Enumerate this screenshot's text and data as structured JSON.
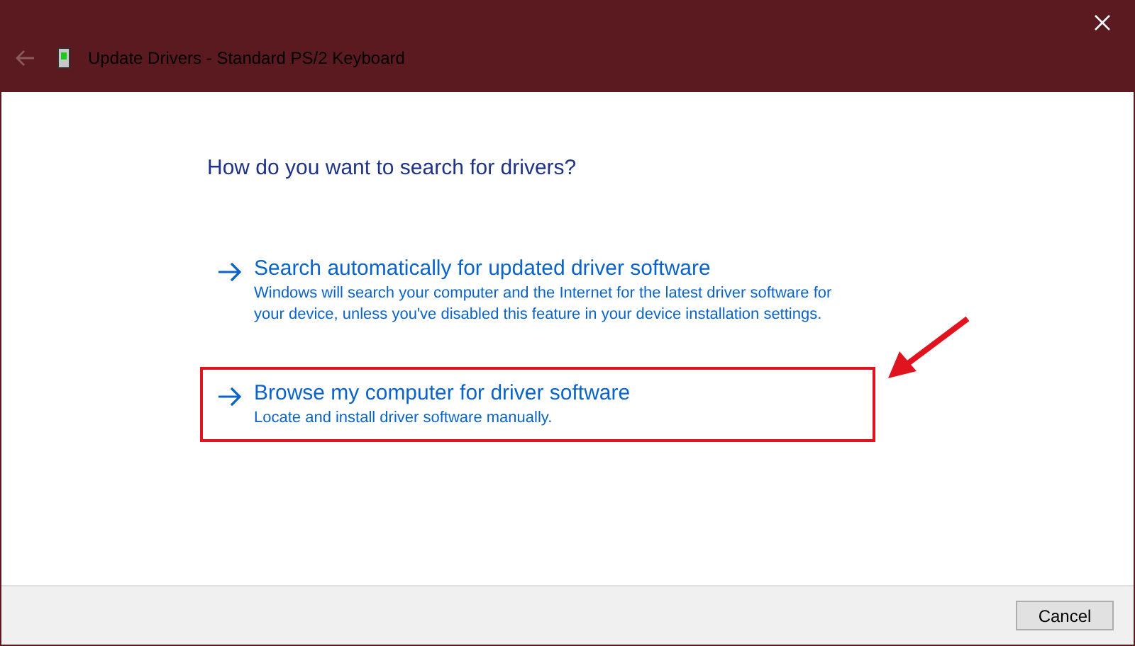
{
  "window": {
    "title": "Update Drivers - Standard PS/2 Keyboard",
    "back_disabled": true
  },
  "heading": "How do you want to search for drivers?",
  "options": [
    {
      "title": "Search automatically for updated driver software",
      "description": "Windows will search your computer and the Internet for the latest driver software for your device, unless you've disabled this feature in your device installation settings.",
      "highlighted": false
    },
    {
      "title": "Browse my computer for driver software",
      "description": "Locate and install driver software manually.",
      "highlighted": true
    }
  ],
  "buttons": [
    "Cancel"
  ]
}
